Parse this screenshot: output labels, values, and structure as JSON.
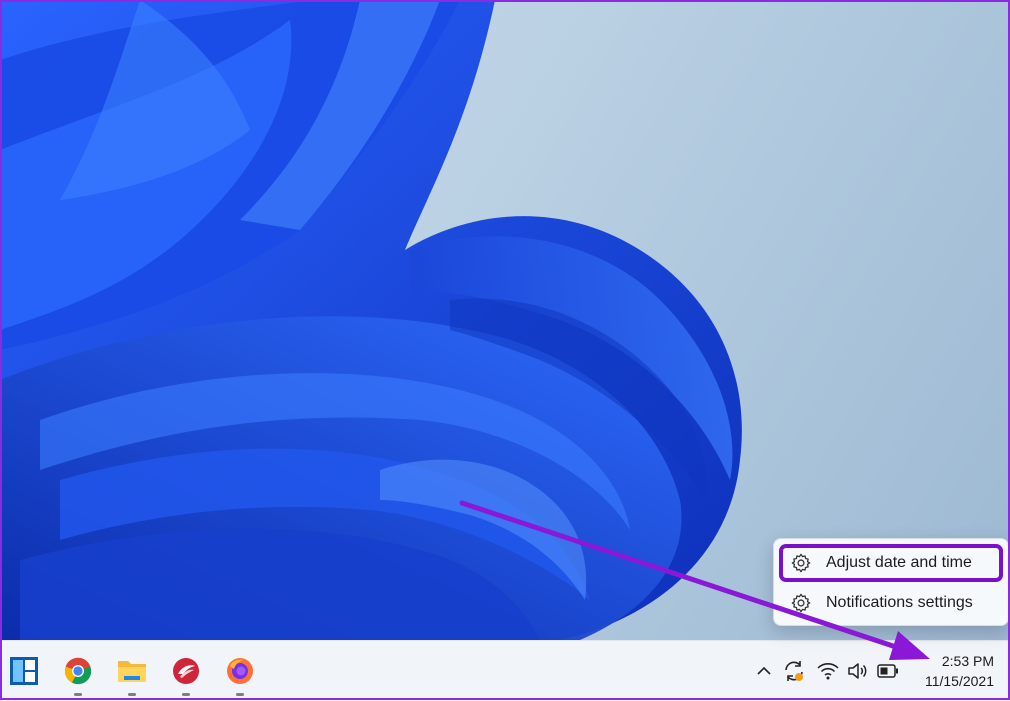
{
  "context_menu": {
    "items": [
      {
        "label": "Adjust date and time",
        "icon": "gear-icon",
        "highlighted": true
      },
      {
        "label": "Notifications settings",
        "icon": "gear-icon",
        "highlighted": false
      }
    ]
  },
  "taskbar": {
    "apps": [
      {
        "name": "start",
        "icon": "windows-start-icon",
        "running": false
      },
      {
        "name": "chrome",
        "icon": "chrome-icon",
        "running": true
      },
      {
        "name": "file-explorer",
        "icon": "folder-icon",
        "running": true
      },
      {
        "name": "quill",
        "icon": "quill-icon",
        "running": true
      },
      {
        "name": "firefox",
        "icon": "firefox-icon",
        "running": true
      }
    ],
    "tray": [
      "chevron-up-icon",
      "sync-icon",
      "wifi-icon",
      "volume-icon",
      "battery-icon"
    ],
    "clock": {
      "time": "2:53 PM",
      "date": "11/15/2021"
    }
  },
  "colors": {
    "highlight": "#7b10c9",
    "arrow": "#8a18d6",
    "wallpaper_blue": "#1e4fe0"
  }
}
